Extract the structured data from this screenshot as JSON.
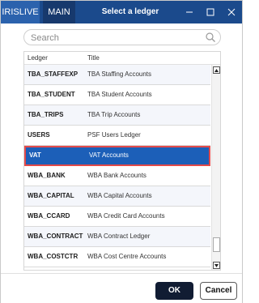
{
  "titlebar": {
    "tabs": [
      {
        "label": "IRISLIVE"
      },
      {
        "label": "MAIN"
      }
    ],
    "title": "Select a ledger",
    "controls": {
      "minimize_icon": "minimize-icon",
      "maximize_icon": "maximize-icon",
      "close_icon": "close-icon"
    },
    "colors": {
      "bar": "#1b4a8c",
      "tab_active": "#2b62ad"
    }
  },
  "search": {
    "placeholder": "Search",
    "value": "",
    "icon": "search-icon"
  },
  "grid": {
    "columns": [
      "Ledger",
      "Title"
    ],
    "rows": [
      {
        "code": "TBA_STAFFEXP",
        "title": "TBA Staffing Accounts"
      },
      {
        "code": "TBA_STUDENT",
        "title": "TBA Student Accounts"
      },
      {
        "code": "TBA_TRIPS",
        "title": "TBA Trip Accounts"
      },
      {
        "code": "USERS",
        "title": "PSF Users Ledger"
      },
      {
        "code": "VAT",
        "title": "VAT Accounts",
        "selected": true
      },
      {
        "code": "WBA_BANK",
        "title": "WBA Bank Accounts"
      },
      {
        "code": "WBA_CAPITAL",
        "title": "WBA Capital Accounts"
      },
      {
        "code": "WBA_CCARD",
        "title": "WBA Credit Card Accounts"
      },
      {
        "code": "WBA_CONTRACT",
        "title": "WBA Contract Ledger"
      },
      {
        "code": "WBA_COSTCTR",
        "title": "WBA Cost Centre Accounts"
      }
    ],
    "selected_color": "#1c5fb8",
    "selected_border_color": "#e24a4a"
  },
  "footer": {
    "ok_label": "OK",
    "cancel_label": "Cancel"
  }
}
